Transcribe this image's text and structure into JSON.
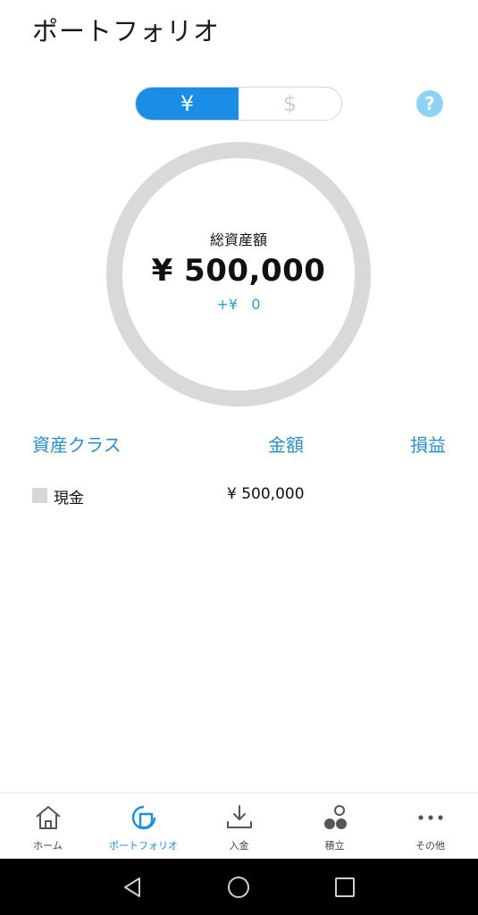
{
  "header": {
    "title": "ポートフォリオ"
  },
  "currency_toggle": {
    "yen_label": "¥",
    "usd_label": "$",
    "selected": "yen"
  },
  "help": {
    "label": "?"
  },
  "summary": {
    "label": "総資産額",
    "total": "¥ 500,000",
    "change": "+¥   0"
  },
  "table": {
    "headers": {
      "asset_class": "資産クラス",
      "amount": "金額",
      "profit_loss": "損益"
    },
    "rows": [
      {
        "name": "現金",
        "amount": "¥ 500,000",
        "profit_loss": ""
      }
    ]
  },
  "nav": {
    "items": [
      {
        "label": "ホーム",
        "icon": "home-icon"
      },
      {
        "label": "ポートフォリオ",
        "icon": "portfolio-icon"
      },
      {
        "label": "入金",
        "icon": "deposit-icon"
      },
      {
        "label": "積立",
        "icon": "savings-icon"
      },
      {
        "label": "その他",
        "icon": "more-icon"
      }
    ],
    "active_index": 1
  },
  "colors": {
    "accent": "#1a8ee6",
    "link": "#2a8fc4",
    "ring": "#d9d9d9",
    "help": "#8ed2f5",
    "change": "#2aa0c8"
  }
}
